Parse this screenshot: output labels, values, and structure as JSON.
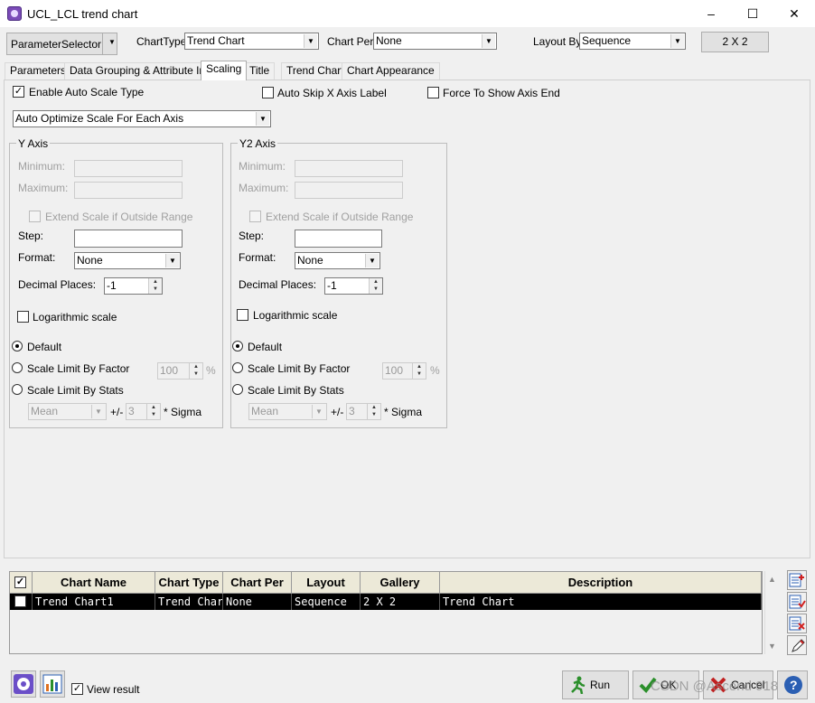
{
  "window": {
    "title": "UCL_LCL trend chart",
    "minimize": "–",
    "maximize": "☐",
    "close": "✕"
  },
  "toolbar": {
    "param_selector": "ParameterSelector",
    "chart_type_label": "ChartType",
    "chart_type_value": "Trend Chart",
    "chart_per_label": "Chart Per:",
    "chart_per_value": "None",
    "layout_by_label": "Layout By",
    "layout_by_value": "Sequence",
    "grid_button": "2 X 2"
  },
  "tabs": [
    "Parameters",
    "Data Grouping & Attribute Info",
    "Scaling",
    "Title",
    "Trend Chart",
    "Chart Appearance"
  ],
  "scaling": {
    "enable_auto_scale": "Enable Auto Scale Type",
    "auto_skip": "Auto Skip X Axis Label",
    "force_show": "Force To Show Axis End",
    "auto_type": "Auto Optimize Scale For Each Axis"
  },
  "y_axis": {
    "title": "Y Axis",
    "minimum": "Minimum:",
    "maximum": "Maximum:",
    "extend": "Extend Scale if Outside Range",
    "step": "Step:",
    "format": "Format:",
    "format_value": "None",
    "decimal": "Decimal Places:",
    "decimal_value": "-1",
    "log": "Logarithmic scale",
    "default": "Default",
    "by_factor": "Scale Limit By Factor",
    "factor_value": "100",
    "pct": "%",
    "by_stats": "Scale Limit By Stats",
    "stat_value": "Mean",
    "pm": "+/-",
    "sigma_value": "3",
    "sigma": "* Sigma"
  },
  "y2_axis": {
    "title": "Y2 Axis",
    "minimum": "Minimum:",
    "maximum": "Maximum:",
    "extend": "Extend Scale if Outside Range",
    "step": "Step:",
    "format": "Format:",
    "format_value": "None",
    "decimal": "Decimal Places:",
    "decimal_value": "-1",
    "log": "Logarithmic scale",
    "default": "Default",
    "by_factor": "Scale Limit By Factor",
    "factor_value": "100",
    "pct": "%",
    "by_stats": "Scale Limit By Stats",
    "stat_value": "Mean",
    "pm": "+/-",
    "sigma_value": "3",
    "sigma": "* Sigma"
  },
  "grid": {
    "headers": [
      "Chart Name",
      "Chart Type",
      "Chart Per",
      "Layout",
      "Gallery",
      "Description"
    ],
    "rows": [
      [
        "Trend Chart1",
        "Trend Chart",
        "None",
        "Sequence",
        "2 X 2",
        "Trend Chart"
      ]
    ]
  },
  "bottom": {
    "view_result": "View result",
    "run": "Run",
    "ok": "OK",
    "cancel": "Cancel"
  },
  "watermark": "CSDN @Ascend 918"
}
